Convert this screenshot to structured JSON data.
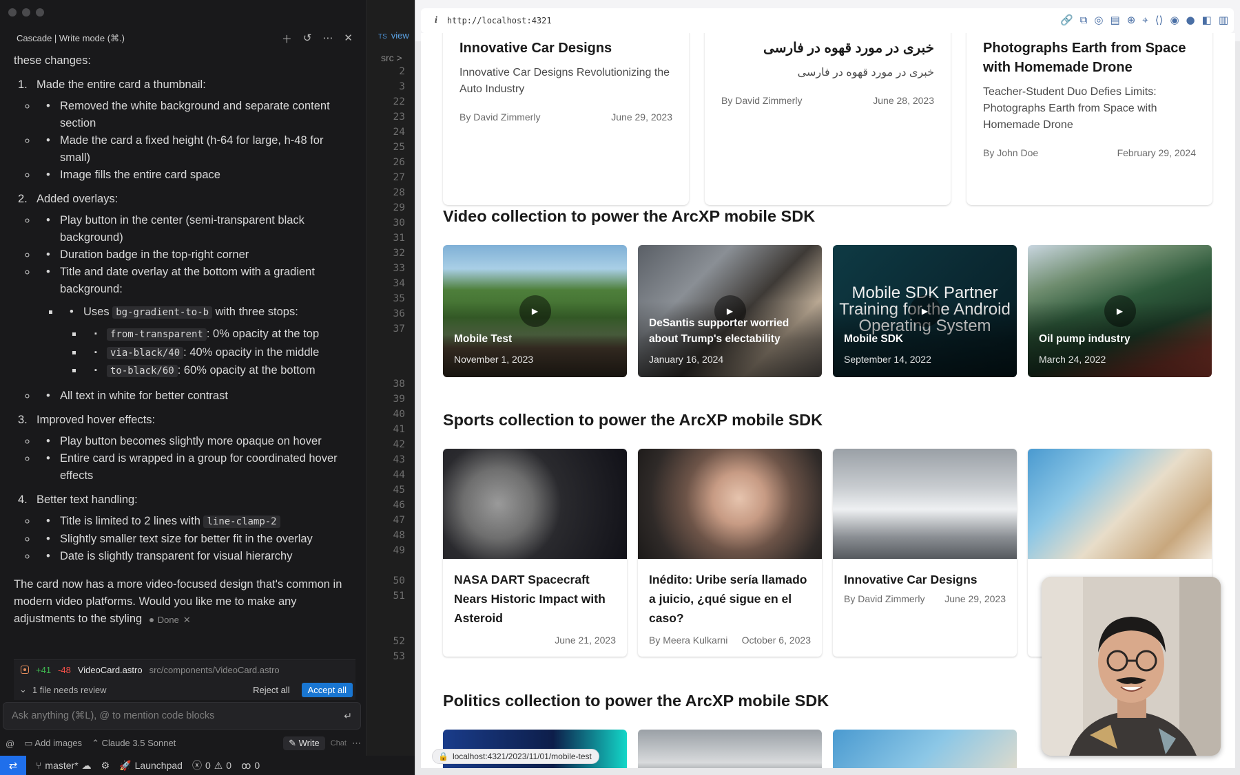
{
  "cascade": {
    "title": "Cascade | Write mode (⌘.)",
    "intro": "these changes:",
    "items": [
      {
        "num": "1.",
        "label": "Made the entire card a thumbnail:",
        "bullets": [
          "Removed the white background and separate content section",
          "Made the card a fixed height (h-64 for large, h-48 for small)",
          "Image fills the entire card space"
        ]
      },
      {
        "num": "2.",
        "label": "Added overlays:",
        "bullets": [
          "Play button in the center (semi-transparent black background)",
          "Duration badge in the top-right corner",
          "Title and date overlay at the bottom with a gradient background:"
        ],
        "sub": {
          "uses_pre": "Uses",
          "uses_code": "bg-gradient-to-b",
          "uses_post": "with three stops:",
          "stops": [
            {
              "code": "from-transparent",
              "text": ": 0% opacity at the top"
            },
            {
              "code": "via-black/40",
              "text": ": 40% opacity in the middle"
            },
            {
              "code": "to-black/60",
              "text": ": 60% opacity at the bottom"
            }
          ]
        },
        "after": "All text in white for better contrast"
      },
      {
        "num": "3.",
        "label": "Improved hover effects:",
        "bullets": [
          "Play button becomes slightly more opaque on hover",
          "Entire card is wrapped in a group for coordinated hover effects"
        ]
      },
      {
        "num": "4.",
        "label": "Better text handling:",
        "bullets_code": {
          "pre": "Title is limited to 2 lines with",
          "code": "line-clamp-2"
        },
        "bullets": [
          "Slightly smaller text size for better fit in the overlay",
          "Date is slightly transparent for visual hierarchy"
        ]
      }
    ],
    "closing": "The card now has a more video-focused design that's common in modern video platforms. Would you like me to make any adjustments to the styling",
    "done_label": "Done",
    "review": {
      "additions": "+41",
      "deletions": "-48",
      "file_name": "VideoCard.astro",
      "file_path": "src/components/VideoCard.astro",
      "needs_review": "1 file needs review",
      "reject_all": "Reject all",
      "accept_all": "Accept all"
    },
    "input_placeholder": "Ask anything (⌘L), @ to mention code blocks",
    "add_images": "Add images",
    "model": "Claude 3.5 Sonnet",
    "write_label": "Write",
    "chat_label": "Chat"
  },
  "editor": {
    "tab_lang": "TS",
    "tab_name": "view",
    "crumb": "src >",
    "line_numbers_top": [
      "2",
      "3",
      "22",
      "23",
      "24",
      "25",
      "26",
      "27",
      "28",
      "29",
      "30",
      "31",
      "32",
      "33",
      "34",
      "35",
      "36",
      "37"
    ],
    "line_numbers_mid": [
      "38",
      "39",
      "40",
      "41",
      "42",
      "43",
      "44",
      "45",
      "46",
      "47",
      "48",
      "49"
    ],
    "line_numbers_low": [
      "50",
      "51"
    ],
    "line_numbers_bottom": [
      "52",
      "53"
    ]
  },
  "statusbar": {
    "branch": "master*",
    "launchpad": "Launchpad",
    "problems": "0",
    "warnings": "0",
    "ports": "0"
  },
  "browser": {
    "url": "http://localhost:4321",
    "hover_link": "localhost:4321/2023/11/01/mobile-test",
    "top_cards": [
      {
        "title": "Innovative Car Designs",
        "subtitle": "Innovative Car Designs Revolutionizing the Auto Industry",
        "author": "By David Zimmerly",
        "date": "June 29, 2023"
      },
      {
        "title": "خبری در مورد قهوه در فارسی",
        "subtitle": "خبری در مورد قهوه در فارسی",
        "author": "By David Zimmerly",
        "date": "June 28, 2023"
      },
      {
        "title": "Photographs Earth from Space with Homemade Drone",
        "subtitle": "Teacher-Student Duo Defies Limits: Photographs Earth from Space with Homemade Drone",
        "author": "By John Doe",
        "date": "February 29, 2024"
      }
    ],
    "video_heading": "Video collection to power the ArcXP mobile SDK",
    "videos": [
      {
        "title": "Mobile Test",
        "date": "November 1, 2023"
      },
      {
        "title": "DeSantis supporter worried about Trump's electability",
        "date": "January 16, 2024"
      },
      {
        "title": "Mobile SDK",
        "date": "September 14, 2022",
        "image_text": "Mobile SDK Partner Training for the Android Operating System"
      },
      {
        "title": "Oil pump industry",
        "date": "March 24, 2022"
      }
    ],
    "sports_heading": "Sports collection to power the ArcXP mobile SDK",
    "sports": [
      {
        "title": "NASA DART Spacecraft Nears Historic Impact with Asteroid",
        "author": "",
        "date": "June 21, 2023"
      },
      {
        "title": "Inédito: Uribe sería llamado a juicio, ¿qué sigue en el caso?",
        "author": "By Meera Kulkarni",
        "date": "October 6, 2023"
      },
      {
        "title": "Innovative Car Designs",
        "author": "By David Zimmerly",
        "date": "June 29, 2023"
      },
      {
        "title": "",
        "author": "",
        "date": ""
      }
    ],
    "politics_heading": "Politics collection to power the ArcXP mobile SDK"
  }
}
